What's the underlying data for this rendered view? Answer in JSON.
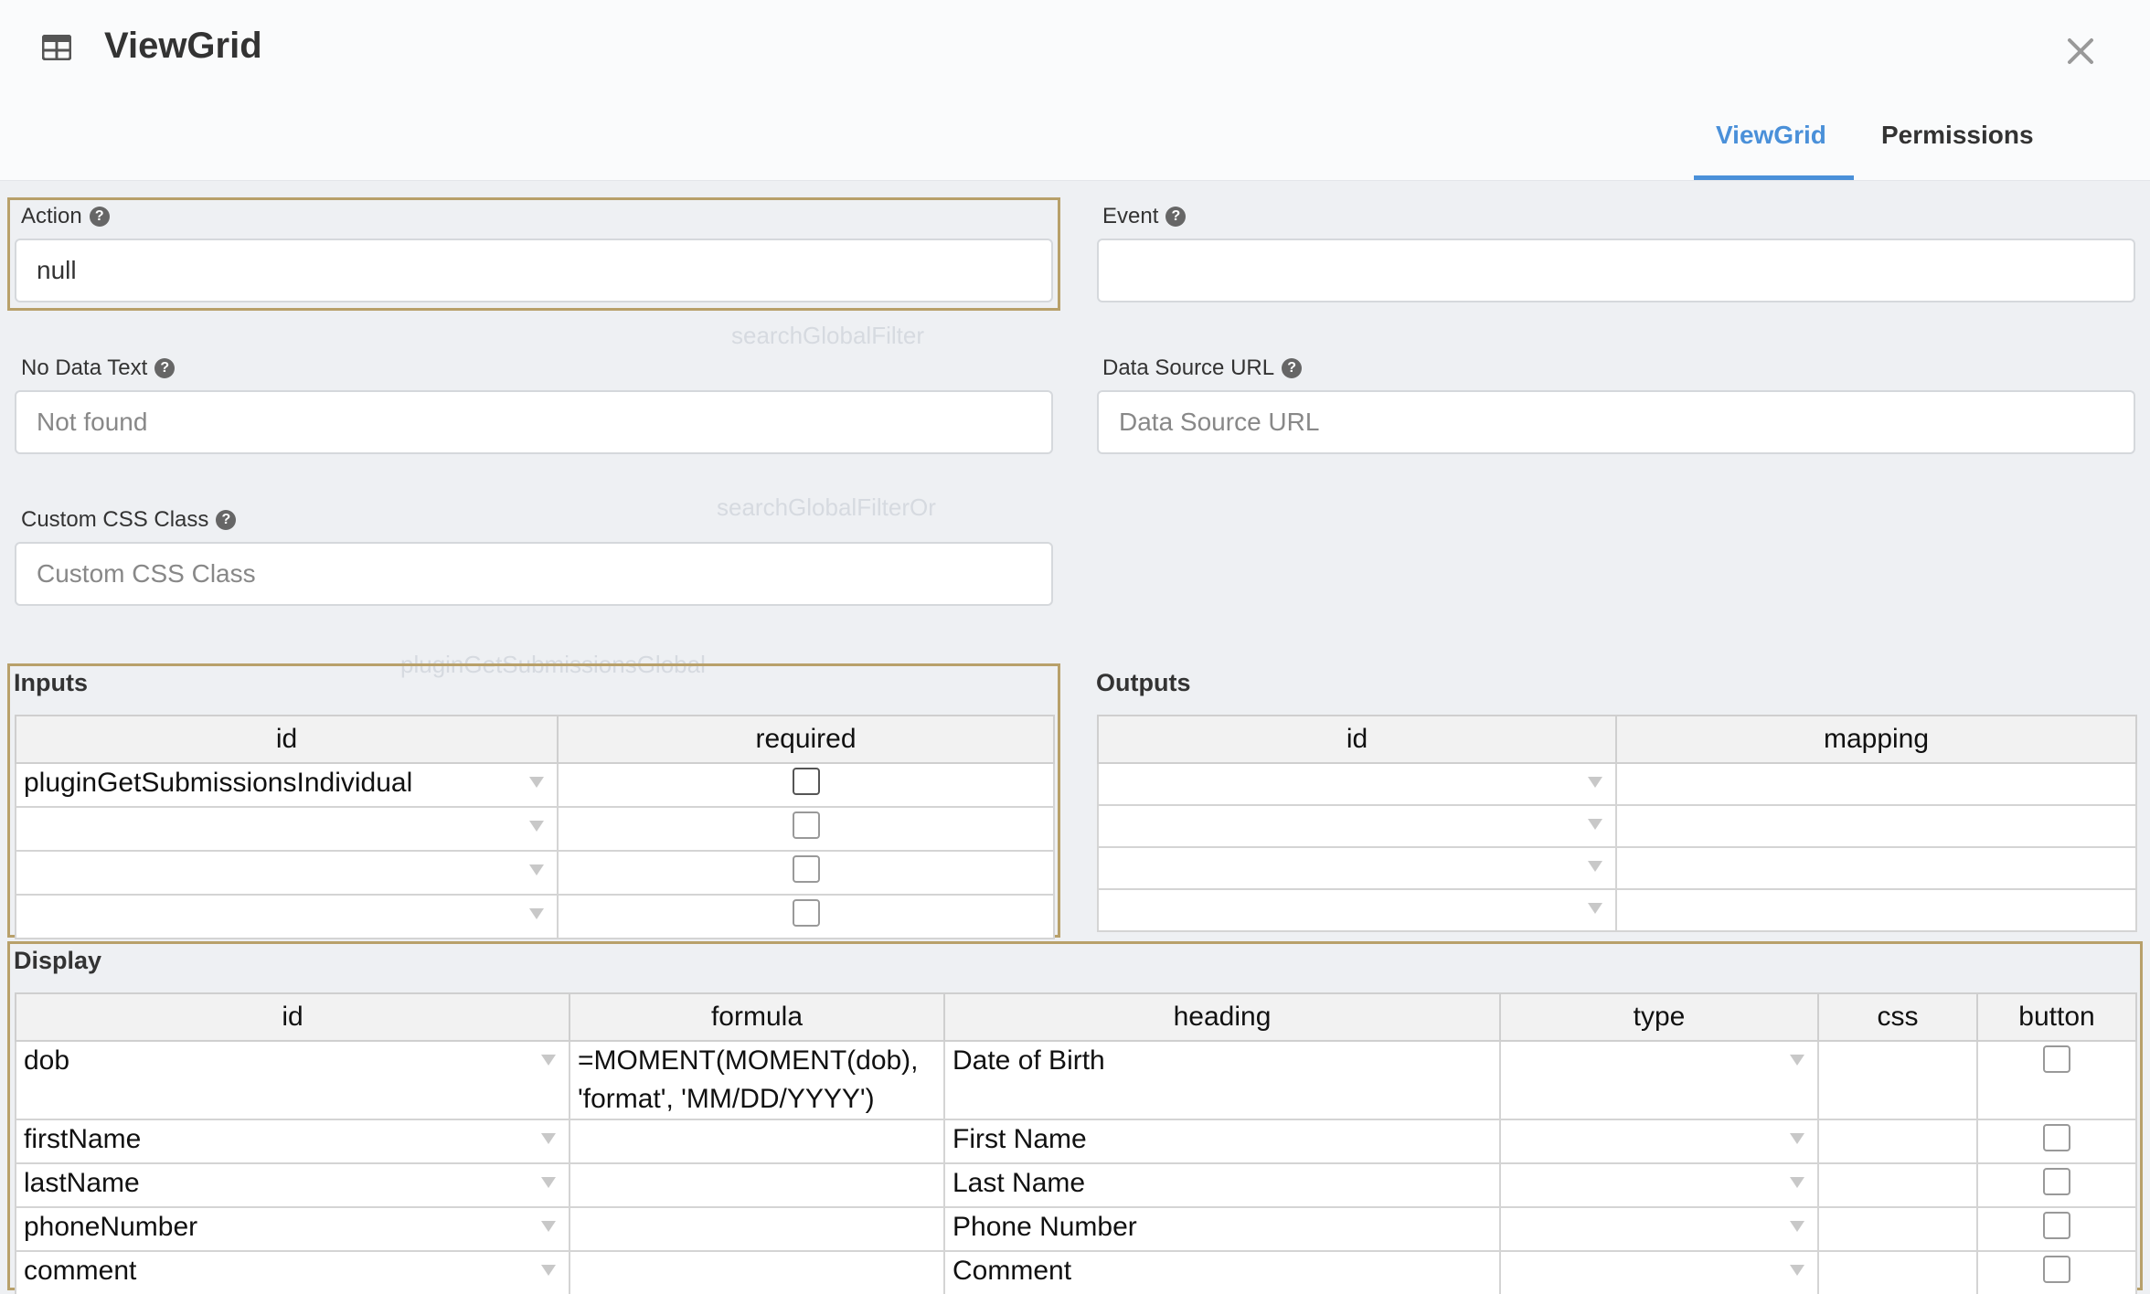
{
  "header": {
    "title": "ViewGrid",
    "icon": "table-icon",
    "tabs": [
      {
        "label": "ViewGrid",
        "active": true
      },
      {
        "label": "Permissions",
        "active": false
      }
    ]
  },
  "form": {
    "action": {
      "label": "Action",
      "value": "null"
    },
    "event": {
      "label": "Event",
      "value": ""
    },
    "no_data_text": {
      "label": "No Data Text",
      "placeholder": "Not found"
    },
    "data_source_url": {
      "label": "Data Source URL",
      "placeholder": "Data Source URL"
    },
    "custom_css_class": {
      "label": "Custom CSS Class",
      "placeholder": "Custom CSS Class"
    }
  },
  "inputs": {
    "title": "Inputs",
    "columns": [
      "id",
      "required"
    ],
    "rows": [
      {
        "id": "pluginGetSubmissionsIndividual",
        "required": false
      },
      {
        "id": "",
        "required": false
      },
      {
        "id": "",
        "required": false
      },
      {
        "id": "",
        "required": false
      }
    ]
  },
  "outputs": {
    "title": "Outputs",
    "columns": [
      "id",
      "mapping"
    ],
    "rows": [
      {
        "id": "",
        "mapping": ""
      },
      {
        "id": "",
        "mapping": ""
      },
      {
        "id": "",
        "mapping": ""
      },
      {
        "id": "",
        "mapping": ""
      }
    ]
  },
  "display": {
    "title": "Display",
    "columns": [
      "id",
      "formula",
      "heading",
      "type",
      "css",
      "button"
    ],
    "rows": [
      {
        "id": "dob",
        "formula": "=MOMENT(MOMENT(dob), 'format', 'MM/DD/YYYY')",
        "heading": "Date of Birth",
        "type": "",
        "css": "",
        "button": false
      },
      {
        "id": "firstName",
        "formula": "",
        "heading": "First Name",
        "type": "",
        "css": "",
        "button": false
      },
      {
        "id": "lastName",
        "formula": "",
        "heading": "Last Name",
        "type": "",
        "css": "",
        "button": false
      },
      {
        "id": "phoneNumber",
        "formula": "",
        "heading": "Phone Number",
        "type": "",
        "css": "",
        "button": false
      },
      {
        "id": "comment",
        "formula": "",
        "heading": "Comment",
        "type": "",
        "css": "",
        "button": false
      }
    ]
  },
  "colors": {
    "accent": "#4a90d9",
    "highlight_border": "#b8a06a"
  }
}
